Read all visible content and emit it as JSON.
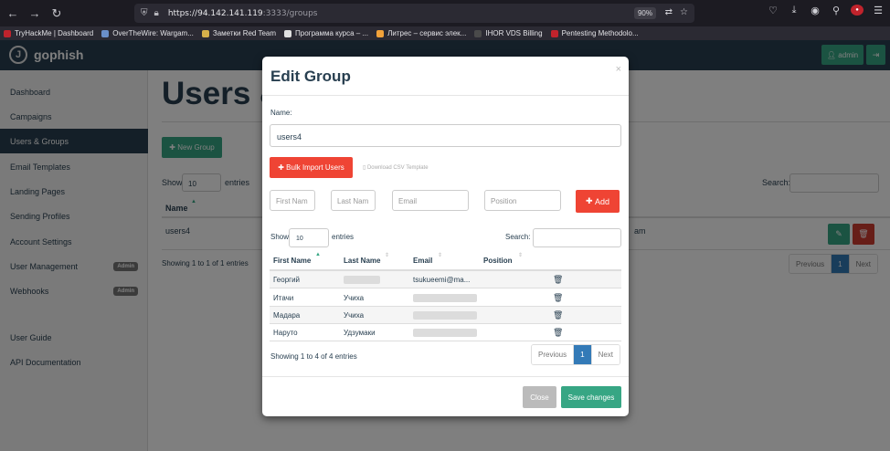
{
  "browser": {
    "url_host": "https://94.142.141.119",
    "url_path": ":3333/groups",
    "zoom": "90%",
    "bookmarks": [
      {
        "label": "TryHackMe | Dashboard",
        "color": "#c0232c"
      },
      {
        "label": "OverTheWire: Wargam...",
        "color": "#6a8fc9"
      },
      {
        "label": "Заметки Red Team",
        "color": "#d6b04a"
      },
      {
        "label": "Программа курса – ...",
        "color": "#e0e0e0"
      },
      {
        "label": "Литрес – сервис элек...",
        "color": "#f2a23a"
      },
      {
        "label": "IHOR VDS Billing",
        "color": "#4a4a4a"
      },
      {
        "label": "Pentesting Methodolo...",
        "color": "#c0232c"
      }
    ]
  },
  "header": {
    "logo_text": "gophish",
    "admin_label": "admin"
  },
  "sidebar": {
    "items": [
      {
        "label": "Dashboard"
      },
      {
        "label": "Campaigns"
      },
      {
        "label": "Users & Groups",
        "active": true
      },
      {
        "label": "Email Templates"
      },
      {
        "label": "Landing Pages"
      },
      {
        "label": "Sending Profiles"
      },
      {
        "label": "Account Settings"
      },
      {
        "label": "User Management",
        "badge": "Admin"
      },
      {
        "label": "Webhooks",
        "badge": "Admin"
      },
      {
        "label": "User Guide"
      },
      {
        "label": "API Documentation"
      }
    ]
  },
  "main": {
    "title": "Users &",
    "new_group": "New Group",
    "show": "Show",
    "show_value": "10",
    "entries": "entries",
    "search": "Search:",
    "col_name": "Name",
    "row_name": "users4",
    "row_tail": "am",
    "showing": "Showing 1 to 1 of 1 entries",
    "pager": {
      "prev": "Previous",
      "page": "1",
      "next": "Next"
    }
  },
  "modal": {
    "title": "Edit Group",
    "name_label": "Name:",
    "name_value": "users4",
    "bulk_import": "Bulk Import Users",
    "download_csv": "Download CSV Template",
    "placeholders": {
      "first_name": "First Nam",
      "last_name": "Last Nam",
      "email": "Email",
      "position": "Position"
    },
    "add": "Add",
    "show": "Show",
    "show_value": "10",
    "entries": "entries",
    "search": "Search:",
    "columns": [
      "First Name",
      "Last Name",
      "Email",
      "Position"
    ],
    "rows": [
      {
        "first": "Георгий",
        "last": "",
        "email": "tsukueemi@ma..."
      },
      {
        "first": "Итачи",
        "last": "Учиха",
        "email": ""
      },
      {
        "first": "Мадара",
        "last": "Учиха",
        "email": ""
      },
      {
        "first": "Наруто",
        "last": "Удзумаки",
        "email": ""
      }
    ],
    "showing": "Showing 1 to 4 of 4 entries",
    "pager": {
      "prev": "Previous",
      "page": "1",
      "next": "Next"
    },
    "close": "Close",
    "save": "Save changes"
  },
  "colors": {
    "brand_navy": "#283f50",
    "brand_green": "#37a684",
    "danger_red": "#ef4434",
    "pager_blue": "#337ab7"
  },
  "icons": [
    "back-arrow-icon",
    "forward-arrow-icon",
    "reload-icon",
    "shield-icon",
    "lock-icon",
    "translate-icon",
    "star-icon",
    "pocket-icon",
    "download-icon",
    "account-icon",
    "extensions-icon",
    "menu-icon",
    "user-icon",
    "logout-icon",
    "plus-icon",
    "pencil-icon",
    "trash-icon",
    "file-icon",
    "sort-icon"
  ]
}
